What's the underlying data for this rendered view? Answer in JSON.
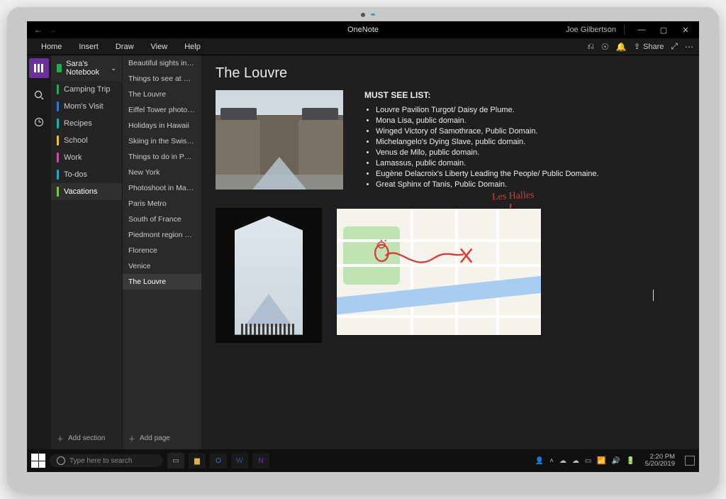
{
  "app": {
    "title": "OneNote",
    "user": "Joe Gilbertson"
  },
  "ribbon": {
    "tabs": [
      "Home",
      "Insert",
      "Draw",
      "View",
      "Help"
    ],
    "share_label": "Share"
  },
  "notebook": {
    "name": "Sara's Notebook",
    "sections": [
      {
        "label": "Camping Trip",
        "color": "#2aa84e"
      },
      {
        "label": "Mom's Visit",
        "color": "#2a7ad6"
      },
      {
        "label": "Recipes",
        "color": "#18b3a6"
      },
      {
        "label": "School",
        "color": "#e0c341"
      },
      {
        "label": "Work",
        "color": "#c94db0"
      },
      {
        "label": "To-dos",
        "color": "#20a8c9"
      },
      {
        "label": "Vacations",
        "color": "#7ac943"
      }
    ],
    "active_section_index": 6,
    "add_section_label": "Add section"
  },
  "pages": {
    "items": [
      "Beautiful sights in Paris",
      "Things to see at Notre…",
      "The Louvre",
      "Eiffel Tower photoshoot",
      "Holidays in Hawaii",
      "Skiing in the Swiss Alps",
      "Things to do in Paris",
      "New York",
      "Photoshoot in Manarola",
      "Paris Metro",
      "South of France",
      "Piedmont region viney…",
      "Florence",
      "Venice",
      "The Louvre"
    ],
    "active_index": 14,
    "add_page_label": "Add page"
  },
  "note": {
    "title": "The Louvre",
    "must_see_heading": "MUST SEE LIST:",
    "must_see": [
      "Louvre Pavilion Turgot/ Daisy de Plume.",
      "Mona Lisa, public domain.",
      "Winged Victory of Samothrace, Public Domain.",
      "Michelangelo's Dying Slave, public domain.",
      "Venus de Milo, public domain.",
      "Lamassus, public domain.",
      "Eugène Delacroix's Liberty Leading the People/ Public Domaine.",
      "Great Sphinx of Tanis, Public Domain."
    ],
    "ink_label": "Les Halles"
  },
  "taskbar": {
    "search_placeholder": "Type here to search",
    "time": "2:20 PM",
    "date": "5/20/2019"
  }
}
